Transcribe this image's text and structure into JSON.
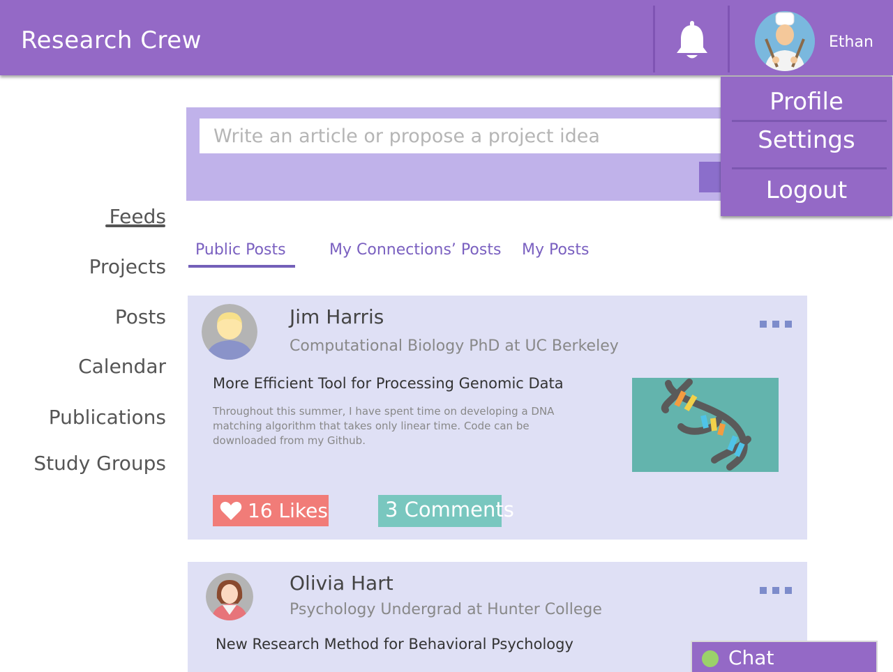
{
  "header": {
    "app_title": "Research Crew",
    "user_name": "Ethan",
    "notifications_icon": "bell-icon",
    "background": "#9469c6"
  },
  "user_menu": {
    "items": [
      "Profile",
      "Settings",
      "Logout"
    ]
  },
  "sidebar": {
    "items": [
      {
        "label": "Feeds",
        "active": true
      },
      {
        "label": "Projects"
      },
      {
        "label": "Posts"
      },
      {
        "label": "Calendar"
      },
      {
        "label": "Publications"
      },
      {
        "label": "Study Groups"
      }
    ]
  },
  "composer": {
    "placeholder": "Write an article or propose a project idea",
    "value": ""
  },
  "tabs": [
    {
      "label": "Public Posts",
      "active": true
    },
    {
      "label": "My Connections’ Posts"
    },
    {
      "label": "My Posts"
    }
  ],
  "posts": [
    {
      "author": "Jim Harris",
      "subtitle": "Computational Biology PhD at UC Berkeley",
      "title": "More Efficient Tool for Processing Genomic Data",
      "body": "Throughout this summer, I have spent time on developing a DNA matching algorithm that takes only linear time. Code can be downloaded from my Github.",
      "image_icon": "dna-icon",
      "likes": "16 Likes",
      "comments": "3 Comments"
    },
    {
      "author": "Olivia Hart",
      "subtitle": "Psychology Undergrad at Hunter College",
      "title": "New Research Method for Behavioral Psychology"
    }
  ],
  "chat": {
    "label": "Chat",
    "status_color": "#9bd16a"
  },
  "colors": {
    "accent": "#9469c6",
    "likes": "#f17c78",
    "comments": "#79c7bf",
    "card": "#dfe0f5"
  }
}
